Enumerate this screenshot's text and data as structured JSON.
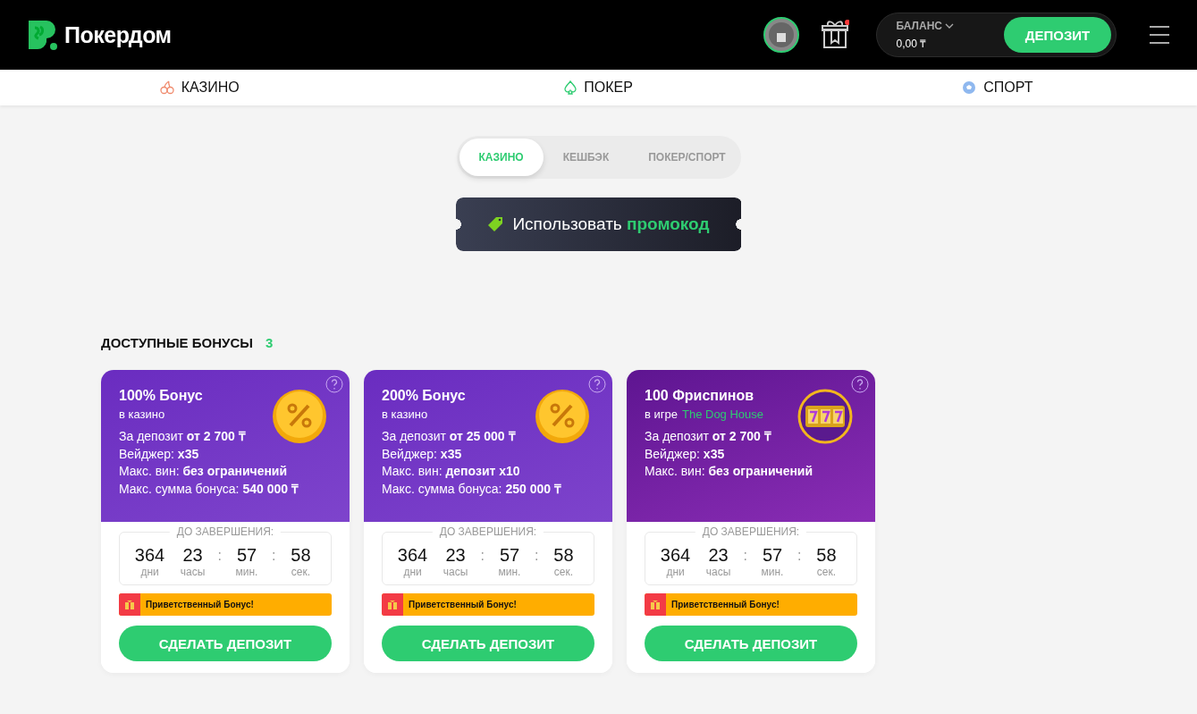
{
  "header": {
    "logo": "Покердом",
    "balance_label": "БАЛАНС",
    "balance": "0,00 ₸",
    "deposit_button": "ДЕПОЗИТ",
    "gift_notification": true
  },
  "nav": [
    {
      "label": "КАЗИНО",
      "kind": "cherry"
    },
    {
      "label": "ПОКЕР",
      "kind": "spade"
    },
    {
      "label": "СПОРТ",
      "kind": "ball"
    }
  ],
  "tabs": [
    {
      "label": "КАЗИНО",
      "selected": true
    },
    {
      "label": "КЕШБЭК",
      "selected": false
    },
    {
      "label": "ПОКЕР/СПОРТ",
      "selected": false
    }
  ],
  "promo": {
    "text": "Использовать **промокод**"
  },
  "section": {
    "title": "ДОСТУПНЫЕ БОНУСЫ",
    "count": "3"
  },
  "cards": [
    {
      "kind": "coin",
      "title": "100% Бонус",
      "subtitle": "в казино",
      "lines": [
        "За депозит **от 2 700 ₸**",
        "Вейджер:  **x35**",
        "Макс. вин: **без ограничений**",
        "Макс. сумма бонуса: **540 000 ₸**"
      ],
      "timer_label": "ДО ЗАВЕРШЕНИЯ:",
      "timer": [
        {
          "kind": "unit",
          "value": "364",
          "unit": "дни"
        },
        {
          "kind": "unit",
          "value": "23",
          "unit": "часы"
        },
        {
          "kind": "separator",
          "text": ":"
        },
        {
          "kind": "unit",
          "value": "57",
          "unit": "мин."
        },
        {
          "kind": "separator",
          "text": ":"
        },
        {
          "kind": "unit",
          "value": "58",
          "unit": "сек."
        }
      ],
      "tag": "Приветственный Бонус!",
      "button": "СДЕЛАТЬ ДЕПОЗИТ"
    },
    {
      "kind": "coin",
      "title": "200% Бонус",
      "subtitle": "в казино",
      "lines": [
        "За депозит **от 25 000 ₸**",
        "Вейджер:  **x35**",
        "Макс. вин: **депозит x10**",
        "Макс. сумма бонуса: **250 000 ₸**"
      ],
      "timer_label": "ДО ЗАВЕРШЕНИЯ:",
      "timer": [
        {
          "kind": "unit",
          "value": "364",
          "unit": "дни"
        },
        {
          "kind": "unit",
          "value": "23",
          "unit": "часы"
        },
        {
          "kind": "separator",
          "text": ":"
        },
        {
          "kind": "unit",
          "value": "57",
          "unit": "мин."
        },
        {
          "kind": "separator",
          "text": ":"
        },
        {
          "kind": "unit",
          "value": "58",
          "unit": "сек."
        }
      ],
      "tag": "Приветственный Бонус!",
      "button": "СДЕЛАТЬ ДЕПОЗИТ"
    },
    {
      "kind": "slot",
      "title": "100 Фриспинов",
      "subtitle": "в игре",
      "game": "The Dog House",
      "lines": [
        "За депозит **от 2 700 ₸**",
        "Вейджер:  **x35**",
        "Макс. вин: **без ограничений**"
      ],
      "timer_label": "ДО ЗАВЕРШЕНИЯ:",
      "timer": [
        {
          "kind": "unit",
          "value": "364",
          "unit": "дни"
        },
        {
          "kind": "unit",
          "value": "23",
          "unit": "часы"
        },
        {
          "kind": "separator",
          "text": ":"
        },
        {
          "kind": "unit",
          "value": "57",
          "unit": "мин."
        },
        {
          "kind": "separator",
          "text": ":"
        },
        {
          "kind": "unit",
          "value": "58",
          "unit": "сек."
        }
      ],
      "tag": "Приветственный Бонус!",
      "button": "СДЕЛАТЬ ДЕПОЗИТ"
    }
  ]
}
